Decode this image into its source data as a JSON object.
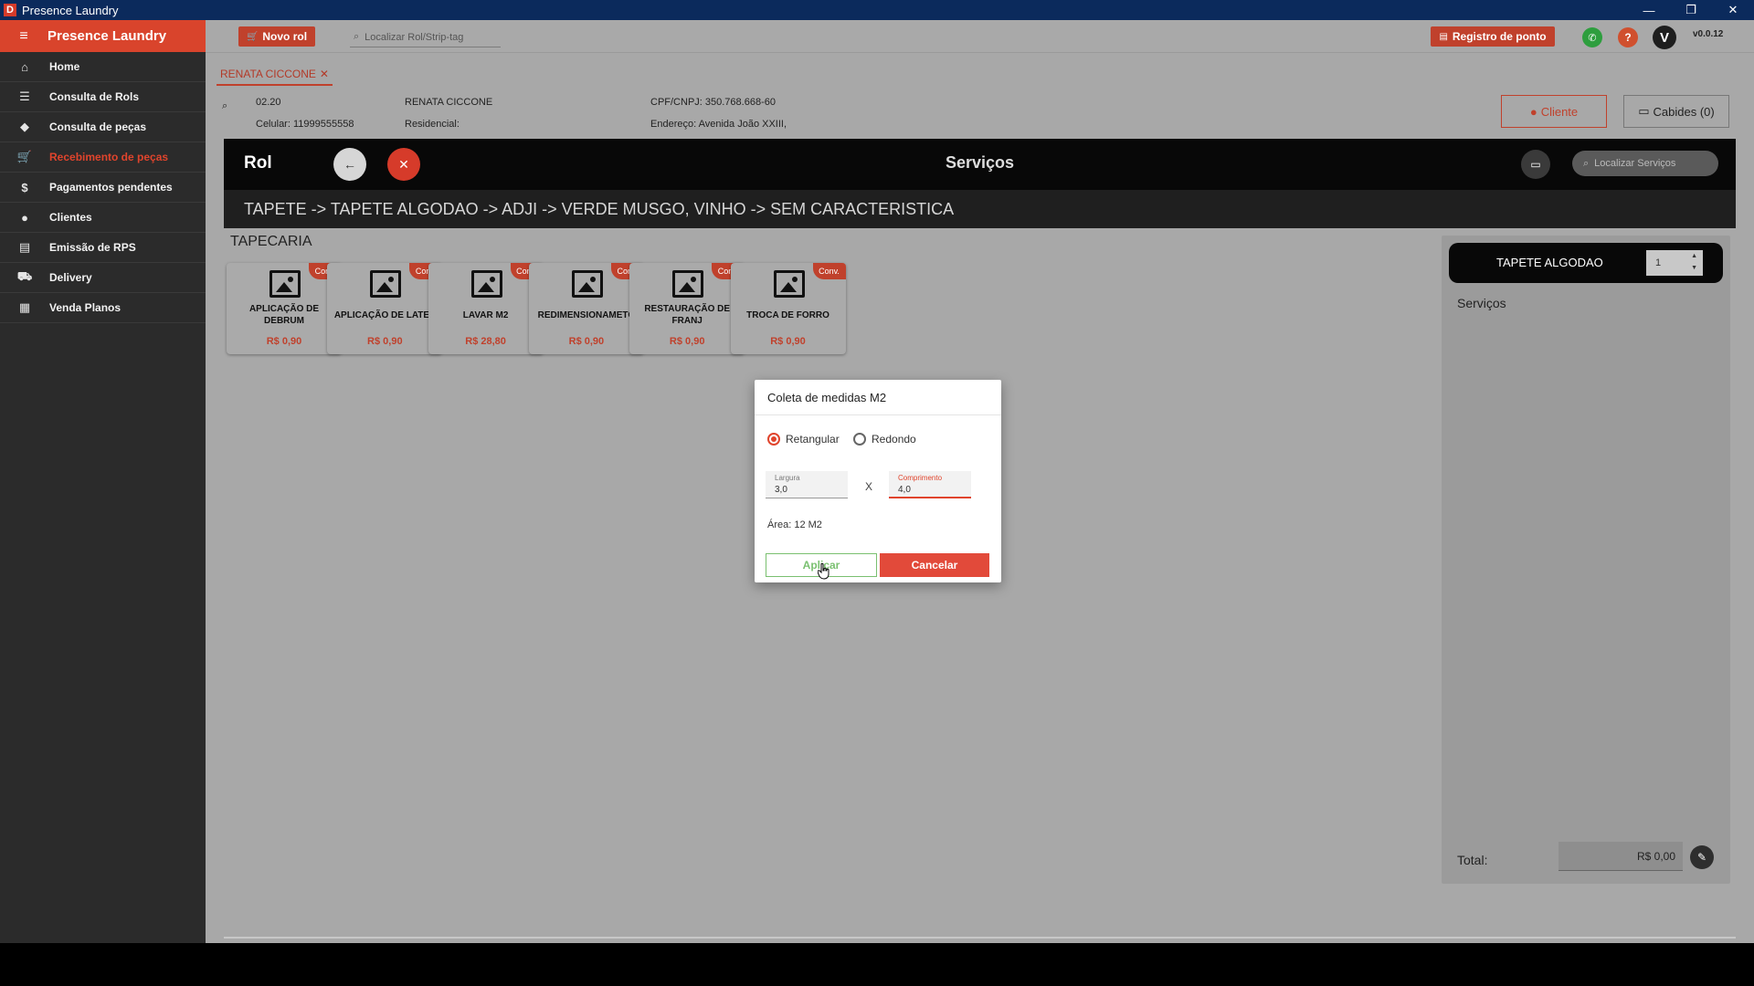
{
  "window": {
    "title": "Presence Laundry",
    "logo_letter": "D",
    "minimize": "—",
    "restore": "❐",
    "close": "✕"
  },
  "sidebar": {
    "brand": "Presence Laundry",
    "items": [
      {
        "label": "Home",
        "icon": "home-icon",
        "glyph": "⌂"
      },
      {
        "label": "Consulta de Rols",
        "icon": "list-icon",
        "glyph": "☰"
      },
      {
        "label": "Consulta de peças",
        "icon": "tag-icon",
        "glyph": "◆"
      },
      {
        "label": "Recebimento de peças",
        "icon": "cart-icon",
        "glyph": "🛒",
        "active": true
      },
      {
        "label": "Pagamentos pendentes",
        "icon": "money-icon",
        "glyph": "$"
      },
      {
        "label": "Clientes",
        "icon": "user-icon",
        "glyph": "●"
      },
      {
        "label": "Emissão de RPS",
        "icon": "document-icon",
        "glyph": "▤"
      },
      {
        "label": "Delivery",
        "icon": "truck-icon",
        "glyph": "⛟"
      },
      {
        "label": "Venda Planos",
        "icon": "plans-icon",
        "glyph": "▦"
      }
    ]
  },
  "topbar": {
    "new_rol": "Novo rol",
    "search_placeholder": "Localizar Rol/Strip-tag",
    "registro": "Registro de ponto",
    "avatar_letter": "V",
    "version": "v0.0.12",
    "colors": {
      "whatsapp": "#2e9e3e",
      "help": "#d0502e",
      "avatar": "#1e1e1e"
    }
  },
  "tab": {
    "label": "RENATA CICCONE",
    "close": "✕"
  },
  "client": {
    "code": "02.20",
    "name": "RENATA CICCONE",
    "cpf": "CPF/CNPJ: 350.768.668-60",
    "celular": "Celular: 11999555558",
    "residencial": "Residencial:",
    "endereco": "Endereço: Avenida João XXIII,",
    "btn_cliente": "Cliente",
    "btn_cabides": "Cabides (0)"
  },
  "rol": {
    "title": "Rol",
    "services_title": "Serviços",
    "search_placeholder": "Localizar Serviços",
    "breadcrumb": "TAPETE -> TAPETE ALGODAO -> ADJI -> VERDE MUSGO, VINHO -> SEM CARACTERISTICA"
  },
  "category": "TAPECARIA",
  "services": [
    {
      "name": "APLICAÇÃO DE DEBRUM",
      "price": "R$ 0,90",
      "badge": "Conv."
    },
    {
      "name": "APLICAÇÃO DE LATEX",
      "price": "R$ 0,90",
      "badge": "Conv."
    },
    {
      "name": "LAVAR M2",
      "price": "R$ 28,80",
      "badge": "Conv."
    },
    {
      "name": "REDIMENSIONAMETO",
      "price": "R$ 0,90",
      "badge": "Conv."
    },
    {
      "name": "RESTAURAÇÃO DE FRANJ",
      "price": "R$ 0,90",
      "badge": "Conv."
    },
    {
      "name": "TROCA DE FORRO",
      "price": "R$ 0,90",
      "badge": "Conv."
    }
  ],
  "panel": {
    "item": "TAPETE ALGODAO",
    "qty": "1",
    "services_label": "Serviços",
    "total_label": "Total:",
    "total_value": "R$ 0,00"
  },
  "dialog": {
    "title": "Coleta de medidas M2",
    "radio_rect": "Retangular",
    "radio_round": "Redondo",
    "largura_label": "Largura",
    "largura_value": "3,0",
    "comprimento_label": "Comprimento",
    "comprimento_value": "4,0",
    "x": "X",
    "area": "Área: 12 M2",
    "apply": "Aplicar",
    "cancel": "Cancelar"
  }
}
